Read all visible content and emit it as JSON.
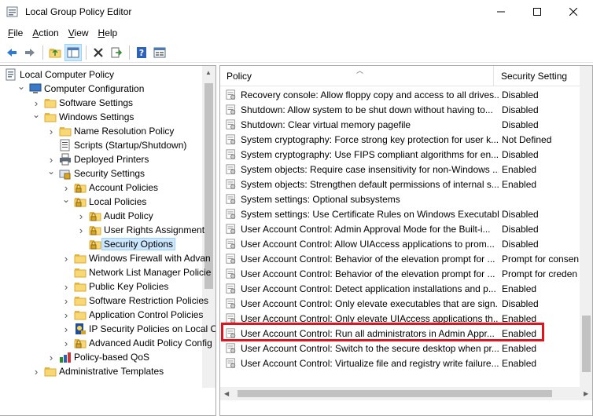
{
  "window": {
    "title": "Local Group Policy Editor",
    "minimize_glyph": "—",
    "maximize_glyph": "☐",
    "close_glyph": "✕"
  },
  "menu": [
    {
      "label": "File",
      "key": "F",
      "rest": "ile"
    },
    {
      "label": "Action",
      "key": "A",
      "rest": "ction"
    },
    {
      "label": "View",
      "key": "V",
      "rest": "iew"
    },
    {
      "label": "Help",
      "key": "H",
      "rest": "elp"
    }
  ],
  "toolbar": {
    "icons": [
      "back-icon",
      "forward-icon",
      "up-folder-icon",
      "show-hide-tree-icon",
      "delete-icon",
      "export-icon",
      "help-icon",
      "properties-icon"
    ]
  },
  "tree": {
    "items": [
      {
        "label": "Local Computer Policy",
        "icon": "computer-policy-icon",
        "indent": 0,
        "expander": ""
      },
      {
        "label": "Computer Configuration",
        "icon": "computer-icon",
        "indent": 1,
        "expander": "open"
      },
      {
        "label": "Software Settings",
        "icon": "folder-icon",
        "indent": 2,
        "expander": "closed"
      },
      {
        "label": "Windows Settings",
        "icon": "folder-icon",
        "indent": 2,
        "expander": "open"
      },
      {
        "label": "Name Resolution Policy",
        "icon": "folder-icon",
        "indent": 3,
        "expander": "closed"
      },
      {
        "label": "Scripts (Startup/Shutdown)",
        "icon": "scripts-icon",
        "indent": 3,
        "expander": ""
      },
      {
        "label": "Deployed Printers",
        "icon": "printer-icon",
        "indent": 3,
        "expander": "closed"
      },
      {
        "label": "Security Settings",
        "icon": "security-icon",
        "indent": 3,
        "expander": "open"
      },
      {
        "label": "Account Policies",
        "icon": "folder-lock-icon",
        "indent": 4,
        "expander": "closed"
      },
      {
        "label": "Local Policies",
        "icon": "folder-lock-icon",
        "indent": 4,
        "expander": "open"
      },
      {
        "label": "Audit Policy",
        "icon": "folder-lock-icon",
        "indent": 5,
        "expander": "closed"
      },
      {
        "label": "User Rights Assignment",
        "icon": "folder-lock-icon",
        "indent": 5,
        "expander": "closed"
      },
      {
        "label": "Security Options",
        "icon": "folder-lock-icon",
        "indent": 5,
        "expander": "",
        "selected": true
      },
      {
        "label": "Windows Firewall with Advan",
        "icon": "folder-icon",
        "indent": 4,
        "expander": "closed"
      },
      {
        "label": "Network List Manager Policie",
        "icon": "folder-icon",
        "indent": 4,
        "expander": ""
      },
      {
        "label": "Public Key Policies",
        "icon": "folder-icon",
        "indent": 4,
        "expander": "closed"
      },
      {
        "label": "Software Restriction Policies",
        "icon": "folder-icon",
        "indent": 4,
        "expander": "closed"
      },
      {
        "label": "Application Control Policies",
        "icon": "folder-icon",
        "indent": 4,
        "expander": "closed"
      },
      {
        "label": "IP Security Policies on Local C",
        "icon": "ip-security-icon",
        "indent": 4,
        "expander": "closed"
      },
      {
        "label": "Advanced Audit Policy Config",
        "icon": "folder-lock-icon",
        "indent": 4,
        "expander": "closed"
      },
      {
        "label": "Policy-based QoS",
        "icon": "qos-icon",
        "indent": 3,
        "expander": "closed"
      },
      {
        "label": "Administrative Templates",
        "icon": "folder-icon",
        "indent": 2,
        "expander": "closed"
      }
    ]
  },
  "list": {
    "columns": {
      "policy": "Policy",
      "setting": "Security Setting"
    },
    "rows": [
      {
        "policy": "Recovery console: Allow floppy copy and access to all drives...",
        "setting": "Disabled"
      },
      {
        "policy": "Shutdown: Allow system to be shut down without having to...",
        "setting": "Disabled"
      },
      {
        "policy": "Shutdown: Clear virtual memory pagefile",
        "setting": "Disabled"
      },
      {
        "policy": "System cryptography: Force strong key protection for user k...",
        "setting": "Not Defined"
      },
      {
        "policy": "System cryptography: Use FIPS compliant algorithms for en...",
        "setting": "Disabled"
      },
      {
        "policy": "System objects: Require case insensitivity for non-Windows ...",
        "setting": "Enabled"
      },
      {
        "policy": "System objects: Strengthen default permissions of internal s...",
        "setting": "Enabled"
      },
      {
        "policy": "System settings: Optional subsystems",
        "setting": ""
      },
      {
        "policy": "System settings: Use Certificate Rules on Windows Executabl...",
        "setting": "Disabled"
      },
      {
        "policy": "User Account Control: Admin Approval Mode for the Built-i...",
        "setting": "Disabled"
      },
      {
        "policy": "User Account Control: Allow UIAccess applications to prom...",
        "setting": "Disabled"
      },
      {
        "policy": "User Account Control: Behavior of the elevation prompt for ...",
        "setting": "Prompt for consen"
      },
      {
        "policy": "User Account Control: Behavior of the elevation prompt for ...",
        "setting": "Prompt for creden"
      },
      {
        "policy": "User Account Control: Detect application installations and p...",
        "setting": "Enabled"
      },
      {
        "policy": "User Account Control: Only elevate executables that are sign...",
        "setting": "Disabled"
      },
      {
        "policy": "User Account Control: Only elevate UIAccess applications th...",
        "setting": "Enabled"
      },
      {
        "policy": "User Account Control: Run all administrators in Admin Appr...",
        "setting": "Enabled",
        "highlighted": true
      },
      {
        "policy": "User Account Control: Switch to the secure desktop when pr...",
        "setting": "Enabled"
      },
      {
        "policy": "User Account Control: Virtualize file and registry write failure...",
        "setting": "Enabled"
      }
    ]
  },
  "colors": {
    "highlight_border": "#e0141e",
    "selection": "#cce8ff"
  }
}
